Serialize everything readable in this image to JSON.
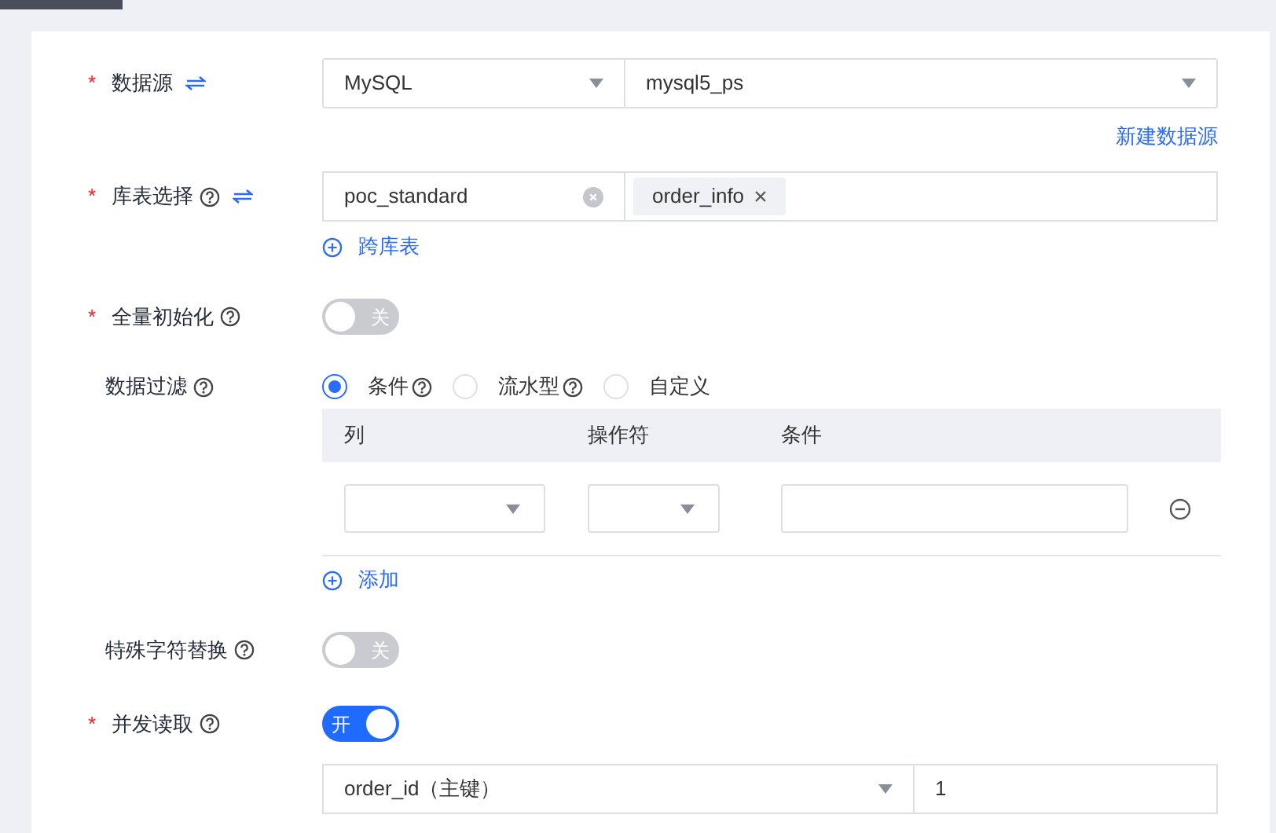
{
  "form": [
    {
      "kind": "select_pair",
      "label": "数据源",
      "required_mark": "*",
      "help": false,
      "swap": true,
      "selects": [
        "MySQL",
        "mysql5_ps"
      ]
    },
    {
      "kind": "link",
      "text": "新建数据源"
    },
    {
      "kind": "table_pick",
      "label": "库表选择",
      "required_mark": "*",
      "help": true,
      "swap": true,
      "database": "poc_standard",
      "tags": [
        "order_info"
      ]
    },
    {
      "kind": "add",
      "text": "跨库表"
    },
    {
      "kind": "toggle",
      "label": "全量初始化",
      "required_mark": "*",
      "help": true,
      "on": false,
      "text": "关"
    },
    {
      "kind": "radio",
      "label": "数据过滤",
      "help": true,
      "options": [
        {
          "label": "条件",
          "help": true,
          "selected": true
        },
        {
          "label": "流水型",
          "help": true,
          "selected": false
        },
        {
          "label": "自定义",
          "help": false,
          "selected": false
        }
      ]
    },
    {
      "kind": "filter_table",
      "columns": [
        "列",
        "操作符",
        "条件"
      ],
      "rows": [
        {
          "removable": true
        }
      ]
    },
    {
      "kind": "add",
      "text": "添加"
    },
    {
      "kind": "toggle",
      "label": "特殊字符替换",
      "help": true,
      "on": false,
      "text": "关"
    },
    {
      "kind": "toggle",
      "label": "并发读取",
      "required_mark": "*",
      "help": true,
      "on": true,
      "text": "开"
    },
    {
      "kind": "select_input",
      "select": "order_id（主键）",
      "value": "1"
    }
  ]
}
